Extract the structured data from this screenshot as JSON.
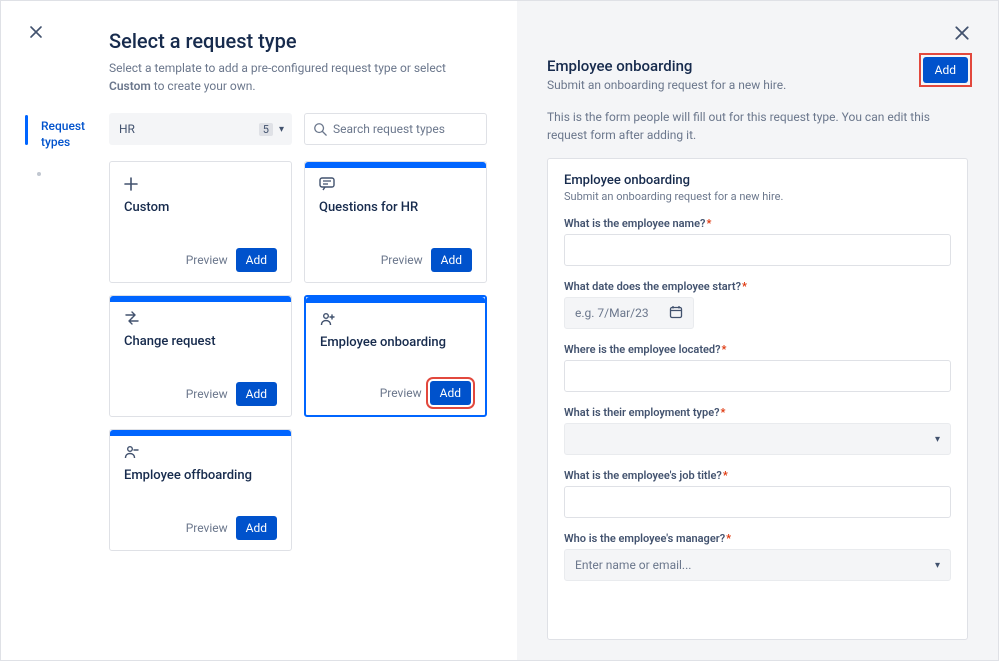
{
  "header": {
    "title": "Select a request type",
    "subtitle_pre": "Select a template to add a pre-configured request type or select ",
    "subtitle_bold": "Custom",
    "subtitle_post": " to create your own."
  },
  "sidebar": {
    "item_label": "Request types"
  },
  "filter": {
    "selected": "HR",
    "count": "5",
    "search_placeholder": "Search request types"
  },
  "cards": [
    {
      "title": "Custom"
    },
    {
      "title": "Questions for HR"
    },
    {
      "title": "Change request"
    },
    {
      "title": "Employee onboarding"
    },
    {
      "title": "Employee offboarding"
    }
  ],
  "card_actions": {
    "preview": "Preview",
    "add": "Add"
  },
  "right": {
    "title": "Employee onboarding",
    "subtitle": "Submit an onboarding request for a new hire.",
    "add_button": "Add",
    "description": "This is the form people will fill out for this request type. You can edit this request form after adding it."
  },
  "form": {
    "title": "Employee onboarding",
    "subtitle": "Submit an onboarding request for a new hire.",
    "fields": {
      "name_label": "What is the employee name?",
      "start_label": "What date does the employee start?",
      "start_placeholder": "e.g. 7/Mar/23",
      "location_label": "Where is the employee located?",
      "employment_type_label": "What is their employment type?",
      "job_title_label": "What is the employee's job title?",
      "manager_label": "Who is the employee's manager?",
      "manager_placeholder": "Enter name or email..."
    }
  }
}
